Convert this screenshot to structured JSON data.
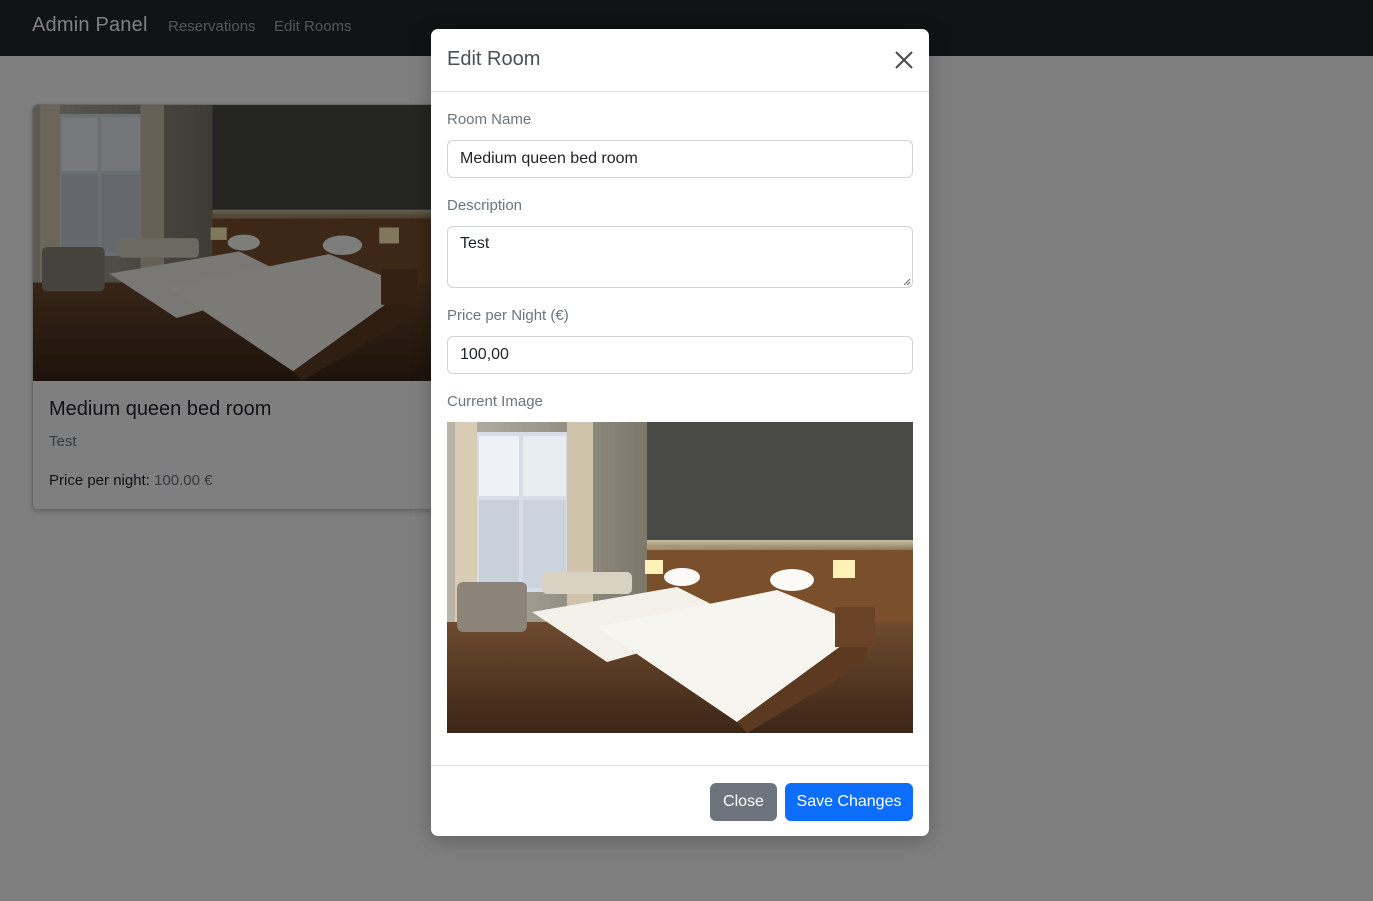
{
  "navbar": {
    "brand": "Admin Panel",
    "links": [
      "Reservations",
      "Edit Rooms"
    ]
  },
  "room_card": {
    "title": "Medium queen bed room",
    "description": "Test",
    "price_label": "Price per night:",
    "price_value": "100.00 €"
  },
  "modal": {
    "title": "Edit Room",
    "fields": {
      "name_label": "Room Name",
      "name_value": "Medium queen bed room",
      "desc_label": "Description",
      "desc_value": "Test",
      "price_label": "Price per Night (€)",
      "price_value": "100,00",
      "image_label": "Current Image"
    },
    "buttons": {
      "close": "Close",
      "save": "Save Changes"
    }
  },
  "colors": {
    "navbar_bg": "#212529",
    "primary": "#0d6efd",
    "secondary": "#6c757d"
  },
  "icons": [
    "close-icon",
    "resize-grip-icon"
  ]
}
